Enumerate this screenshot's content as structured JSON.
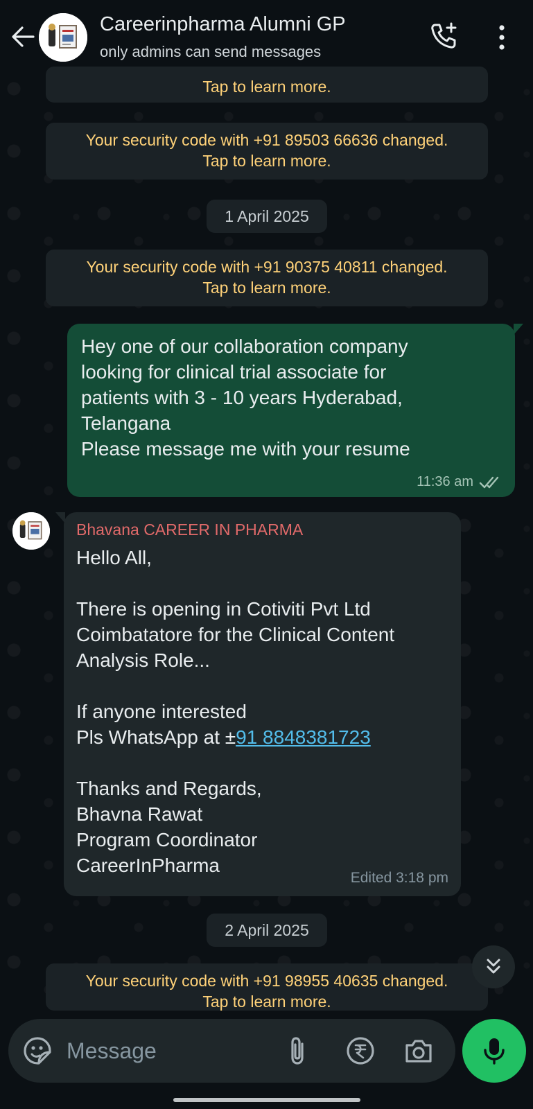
{
  "header": {
    "title": "Careerinpharma Alumni GP",
    "subtitle": "only admins can send messages"
  },
  "chat": {
    "top_partial_notice": "Tap to learn more.",
    "notice_1": {
      "line1": "Your security code with +91 89503 66636 changed.",
      "line2": "Tap to learn more."
    },
    "date_1": "1 April 2025",
    "notice_2": {
      "line1": "Your security code with +91 90375 40811 changed.",
      "line2": "Tap to learn more."
    },
    "outgoing_message": {
      "text": "Hey one of our collaboration company\nlooking for clinical trial associate for\npatients with 3 - 10 years Hyderabad,\nTelangana\nPlease message me with your resume",
      "time": "11:36 am",
      "status": "read"
    },
    "incoming_message": {
      "sender": "Bhavana CAREER IN PHARMA",
      "line1": "Hello All,",
      "line2": "There is opening in Cotiviti Pvt Ltd",
      "line3": "Coimbatatore for the Clinical Content",
      "line4": "Analysis Role...",
      "line5": "If anyone interested",
      "line6_prefix": "Pls WhatsApp at ±",
      "phone": "91 8848381723",
      "line7": "Thanks and Regards,",
      "line8": "Bhavna Rawat",
      "line9": "Program Coordinator",
      "line10": "CareerInPharma",
      "meta": "Edited 3:18 pm"
    },
    "date_2": "2 April 2025",
    "notice_3": {
      "line1": "Your security code with +91 98955 40635 changed.",
      "line2": "Tap to learn more."
    }
  },
  "composer": {
    "placeholder": "Message"
  },
  "icons": {
    "back": "arrow-left-icon",
    "call": "add-call-icon",
    "more": "more-vertical-icon",
    "emoji": "sticker-icon",
    "attach": "paperclip-icon",
    "payment": "rupee-icon",
    "camera": "camera-icon",
    "mic": "microphone-icon",
    "scroll": "double-chevron-down-icon"
  },
  "colors": {
    "accent_green": "#21c063",
    "outgoing_bubble": "#144d37",
    "incoming_bubble": "#1f272a",
    "system_text": "#ffd279",
    "sender_name": "#e26a6a",
    "link": "#53bdeb"
  }
}
